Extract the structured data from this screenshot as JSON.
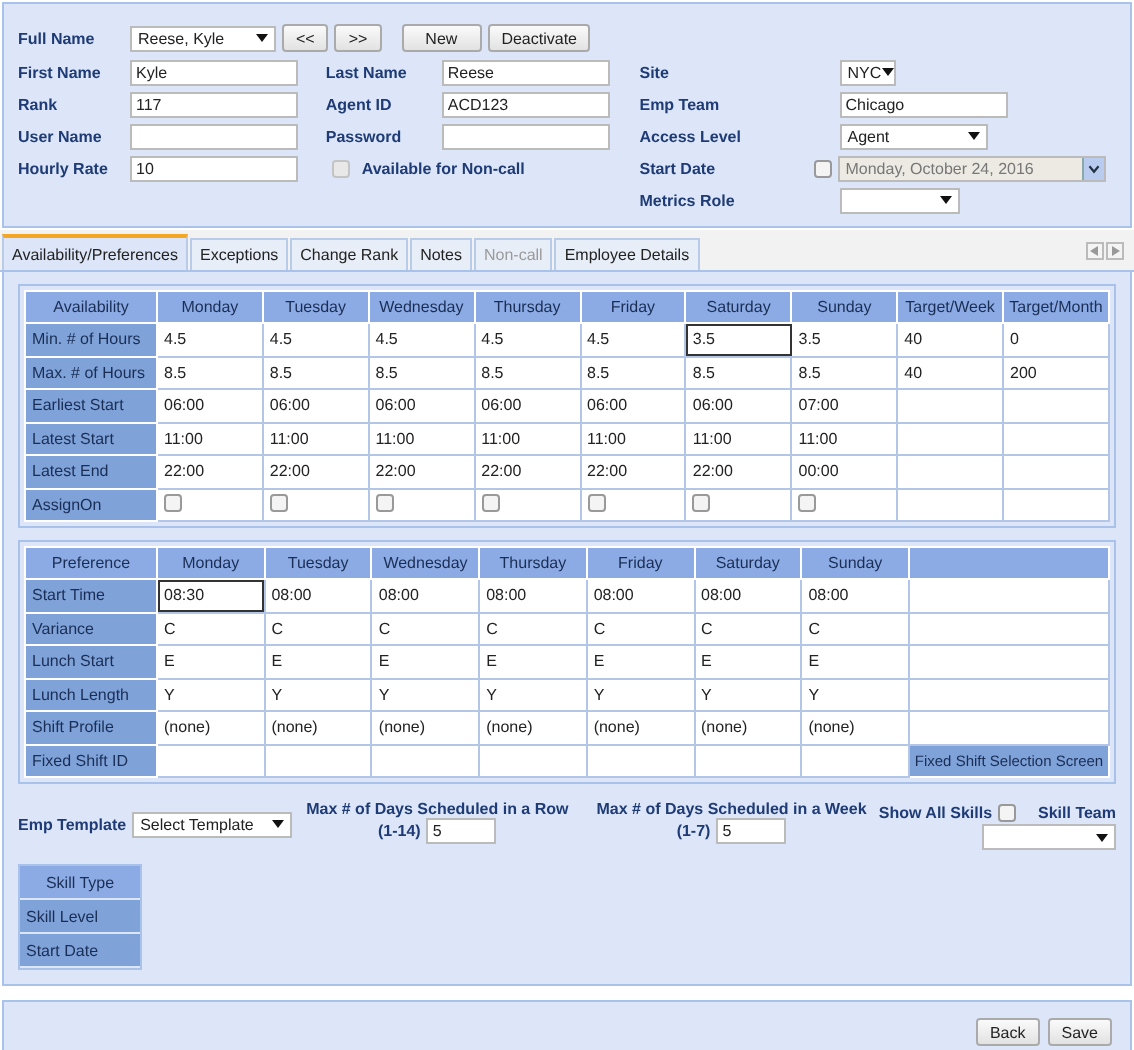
{
  "profile": {
    "full_name": {
      "label": "Full Name",
      "value": "Reese, Kyle"
    },
    "buttons": [
      "<<",
      ">>",
      "New",
      "Deactivate"
    ],
    "columns": [
      [
        {
          "label": "First Name",
          "kind": "text",
          "value": "Kyle"
        },
        {
          "label": "Rank",
          "kind": "text",
          "value": "117"
        },
        {
          "label": "User Name",
          "kind": "text"
        },
        {
          "label": "Hourly Rate",
          "kind": "text",
          "value": "10"
        }
      ],
      [
        {
          "label": "Last Name",
          "kind": "text",
          "value": "Reese"
        },
        {
          "label": "Agent ID",
          "kind": "text",
          "value": "ACD123"
        },
        {
          "label": "Password",
          "kind": "text"
        },
        {
          "label": "Available for Non-call",
          "kind": "checkbox",
          "checked": false,
          "disabled": true
        }
      ],
      [
        {
          "label": "Site",
          "kind": "select",
          "value": "NYC"
        },
        {
          "label": "Emp Team",
          "kind": "text",
          "value": "Chicago"
        },
        {
          "label": "Access Level",
          "kind": "select",
          "value": "Agent"
        },
        {
          "label": "Start Date",
          "kind": "date",
          "value": "Monday, October 24, 2016",
          "checked": false,
          "disabled": true
        },
        {
          "label": "Metrics Role",
          "kind": "select"
        }
      ]
    ]
  },
  "tabs": [
    {
      "label": "Availability/Preferences",
      "selected": true,
      "disabled": false
    },
    {
      "label": "Exceptions",
      "selected": false,
      "disabled": false
    },
    {
      "label": "Change Rank",
      "selected": false,
      "disabled": false
    },
    {
      "label": "Notes",
      "selected": false,
      "disabled": false
    },
    {
      "label": "Non-call",
      "selected": false,
      "disabled": true
    },
    {
      "label": "Employee Details",
      "selected": false,
      "disabled": false
    }
  ],
  "availability": {
    "header": "Availability",
    "columns": [
      "Monday",
      "Tuesday",
      "Wednesday",
      "Thursday",
      "Friday",
      "Saturday",
      "Sunday",
      "Target/Week",
      "Target/Month"
    ],
    "rows": [
      {
        "label": "Min. # of Hours",
        "kind": "text",
        "cells": [
          "4.5",
          "4.5",
          "4.5",
          "4.5",
          "4.5",
          {
            "value": "3.5",
            "focused": true
          },
          "3.5",
          "40",
          "0"
        ]
      },
      {
        "label": "Max. # of Hours",
        "kind": "text",
        "cells": [
          "8.5",
          "8.5",
          "8.5",
          "8.5",
          "8.5",
          "8.5",
          "8.5",
          "40",
          "200"
        ]
      },
      {
        "label": "Earliest Start",
        "kind": "text",
        "cells": [
          "06:00",
          "06:00",
          "06:00",
          "06:00",
          "06:00",
          "06:00",
          "07:00"
        ]
      },
      {
        "label": "Latest Start",
        "kind": "text",
        "cells": [
          "11:00",
          "11:00",
          "11:00",
          "11:00",
          "11:00",
          "11:00",
          "11:00"
        ]
      },
      {
        "label": "Latest End",
        "kind": "text",
        "cells": [
          "22:00",
          "22:00",
          "22:00",
          "22:00",
          "22:00",
          "22:00",
          "00:00"
        ]
      },
      {
        "label": "AssignOn",
        "kind": "checkbox",
        "cells": [
          {
            "checked": false
          },
          {
            "checked": false
          },
          {
            "checked": false
          },
          {
            "checked": false
          },
          {
            "checked": false
          },
          {
            "checked": false
          },
          {
            "checked": false
          }
        ]
      }
    ]
  },
  "preference": {
    "header": "Preference",
    "columns": [
      "Monday",
      "Tuesday",
      "Wednesday",
      "Thursday",
      "Friday",
      "Saturday",
      "Sunday"
    ],
    "rows": [
      {
        "label": "Start Time",
        "cells": [
          {
            "value": "08:30",
            "focused": true
          },
          "08:00",
          "08:00",
          "08:00",
          "08:00",
          "08:00",
          "08:00"
        ]
      },
      {
        "label": "Variance",
        "cells": [
          "C",
          "C",
          "C",
          "C",
          "C",
          "C",
          "C"
        ]
      },
      {
        "label": "Lunch Start",
        "cells": [
          "E",
          "E",
          "E",
          "E",
          "E",
          "E",
          "E"
        ]
      },
      {
        "label": "Lunch Length",
        "cells": [
          "Y",
          "Y",
          "Y",
          "Y",
          "Y",
          "Y",
          "Y"
        ]
      },
      {
        "label": "Shift Profile",
        "cells": [
          "(none)",
          "(none)",
          "(none)",
          "(none)",
          "(none)",
          "(none)",
          "(none)"
        ]
      },
      {
        "label": "Fixed Shift ID",
        "cells": [],
        "action": "Fixed Shift Selection Screen"
      }
    ]
  },
  "options": {
    "emp_template": {
      "label": "Emp Template",
      "value": "Select Template"
    },
    "max_days": [
      {
        "label": "Max # of Days Scheduled in a Row",
        "range": "(1-14)",
        "value": "5"
      },
      {
        "label": "Max # of Days Scheduled in a Week",
        "range": "(1-7)",
        "value": "5"
      }
    ],
    "show_all_skills": {
      "label": "Show All Skills",
      "checked": false
    },
    "skill_team": {
      "label": "Skill Team"
    }
  },
  "skills": [
    "Skill Type",
    "Skill Level",
    "Start Date"
  ],
  "footer_buttons": [
    "Back",
    "Save"
  ]
}
